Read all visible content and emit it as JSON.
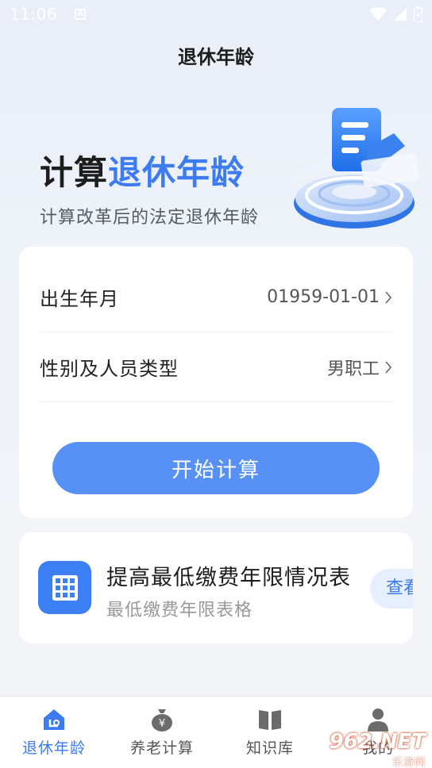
{
  "status_bar": {
    "time": "11:06",
    "notification_glyph": "A"
  },
  "nav": {
    "title": "退休年龄"
  },
  "hero": {
    "title_plain": "计算",
    "title_accent": "退休年龄",
    "subtitle": "计算改革后的法定退休年龄",
    "accent_color": "#3d7bf2"
  },
  "form": {
    "birth": {
      "label": "出生年月",
      "value": "01959-01-01"
    },
    "gender": {
      "label": "性别及人员类型",
      "value": "男职工"
    },
    "submit_label": "开始计算"
  },
  "info_card": {
    "title": "提高最低缴费年限情况表",
    "subtitle": "最低缴费年限表格",
    "view_label": "查看"
  },
  "tabs": [
    {
      "label": "退休年龄",
      "icon": "home-icon",
      "active": true
    },
    {
      "label": "养老计算",
      "icon": "money-bag-icon",
      "active": false
    },
    {
      "label": "知识库",
      "icon": "book-icon",
      "active": false
    },
    {
      "label": "我的",
      "icon": "person-icon",
      "active": false
    }
  ],
  "watermark": {
    "brand": "962.NET",
    "sub": "乐游网"
  }
}
